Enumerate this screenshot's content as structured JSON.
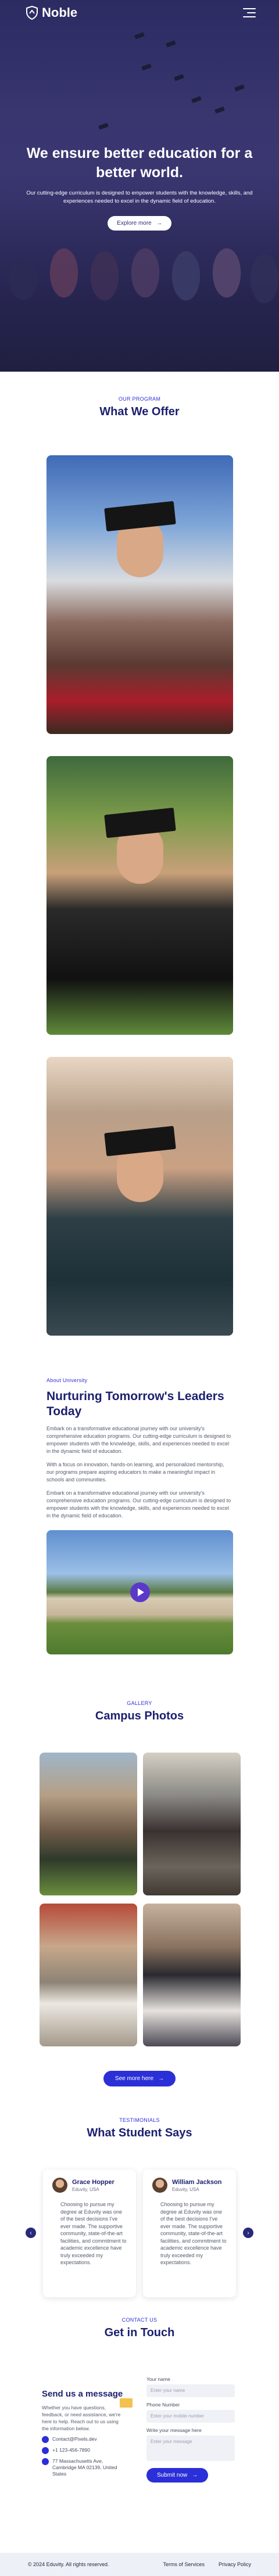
{
  "nav": {
    "brand": "Noble",
    "menu_icon": "hamburger-icon"
  },
  "hero": {
    "title": "We ensure better education for a better world.",
    "subtitle": "Our cutting-edge curriculum is designed to empower students with the knowledge, skills, and experiences needed to excel in the dynamic field of education.",
    "cta_label": "Explore more"
  },
  "offer": {
    "eyebrow": "OUR PROGRAM",
    "title": "What We Offer"
  },
  "about": {
    "eyebrow": "About University",
    "title": "Nurturing Tomorrow's Leaders Today",
    "p1": "Embark on a transformative educational journey with our university's comprehensive education programs. Our cutting-edge curriculum is designed to empower students with the knowledge, skills, and experiences needed to excel in the dynamic field of education.",
    "p2": "With a focus on innovation, hands-on learning, and personalized mentorship, our programs prepare aspiring educators to make a meaningful impact in schools and communities.",
    "p3": "Embark on a transformative educational journey with our university's comprehensive education programs. Our cutting-edge curriculum is designed to empower students with the knowledge, skills, and experiences needed to excel in the dynamic field of education."
  },
  "gallery": {
    "eyebrow": "GALLERY",
    "title": "Campus Photos",
    "cta_label": "See more here"
  },
  "testimonials": {
    "eyebrow": "TESTIMONIALS",
    "title": "What Student Says",
    "items": [
      {
        "name": "Grace Hopper",
        "role": "Eduvity, USA",
        "text": "Choosing to pursue my degree at Eduvity was one of the best decisions I've ever made. The supportive community, state-of-the-art facilities, and commitment to academic excellence have truly exceeded my expectations."
      },
      {
        "name": "William Jackson",
        "role": "Eduvity, USA",
        "text": "Choosing to pursue my degree at Eduvity was one of the best decisions I've ever made. The supportive community, state-of-the-art facilities, and commitment to academic excellence have truly exceeded my expectations."
      }
    ]
  },
  "contact": {
    "eyebrow": "CONTACT US",
    "title": "Get in Touch",
    "heading": "Send us a message",
    "body": "Whether you have questions, feedback, or need assistance, we're here to help. Reach out to us using the information below.",
    "email": "Contact@Pixels.dev",
    "phone": "+1 123-456-7890",
    "address": "77 Massachusetts Ave, Cambridge MA 02139, United States",
    "name_label": "Your name",
    "name_placeholder": "Enter your name",
    "phone_label": "Phone Number",
    "phone_placeholder": "Enter your mobile number",
    "message_label": "Write your message here",
    "message_placeholder": "Enter your message",
    "submit_label": "Submit now"
  },
  "footer": {
    "copyright": "© 2024 Eduvity. All rights reserved.",
    "terms": "Terms of Services",
    "privacy": "Privacy Policy"
  },
  "colors": {
    "primary": "#2b2fd8",
    "navy": "#1b1f6e",
    "hero_overlay": "#2c2b62"
  }
}
